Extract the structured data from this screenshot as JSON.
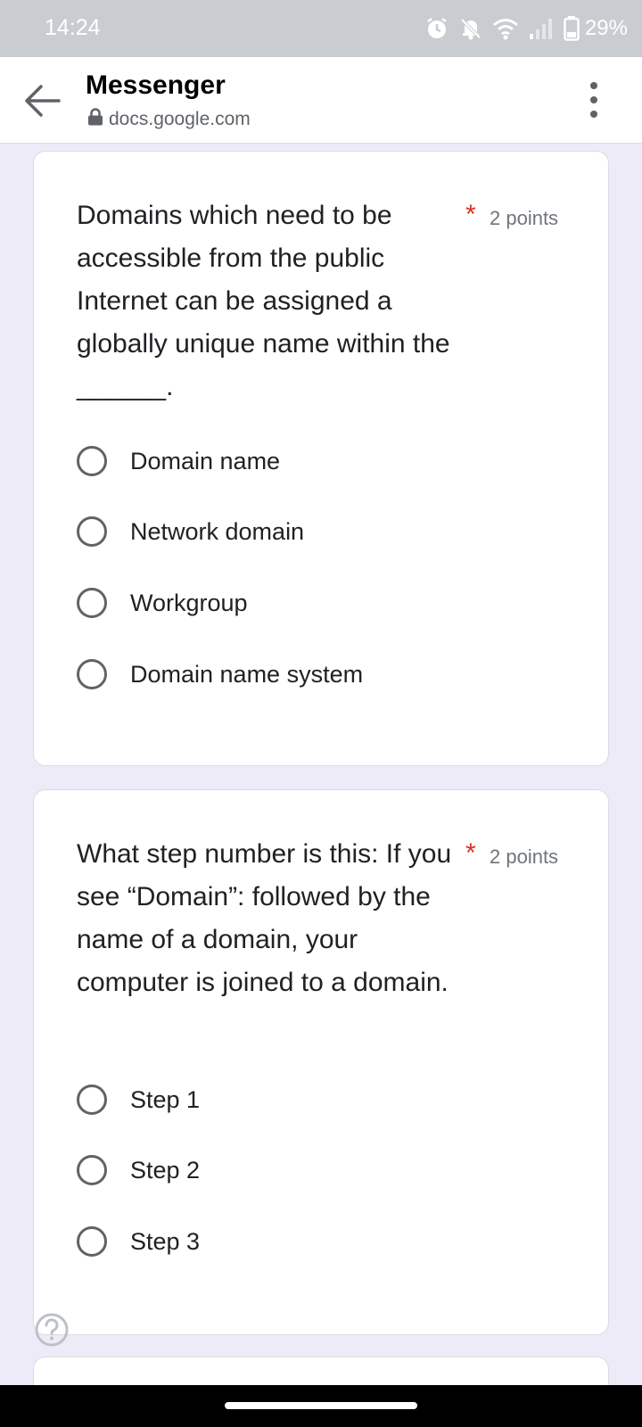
{
  "status_bar": {
    "time": "14:24",
    "battery": "29%",
    "icons": [
      "alarm-icon",
      "bell-off-icon",
      "wifi-icon",
      "signal-icon",
      "battery-icon"
    ]
  },
  "app_bar": {
    "title": "Messenger",
    "url": "docs.google.com",
    "icons": [
      "back-arrow-icon",
      "lock-icon",
      "more-vert-icon"
    ]
  },
  "questions": [
    {
      "text": "Domains which need to be accessible from the public Internet can be assigned a globally unique name within the ______.",
      "required_mark": "*",
      "points": "2 points",
      "options": [
        "Domain name",
        "Network domain",
        "Workgroup",
        "Domain name system"
      ]
    },
    {
      "text": "What step number is this:    If you see “Domain”: followed by the name of a domain, your computer is joined to a domain.",
      "required_mark": "*",
      "points": "2 points",
      "options": [
        "Step 1",
        "Step 2",
        "Step 3"
      ]
    }
  ],
  "colors": {
    "page_background": "#eeebf8",
    "status_bar": "#c9ccd1",
    "required": "#d93025",
    "radio": "#5f6368"
  }
}
